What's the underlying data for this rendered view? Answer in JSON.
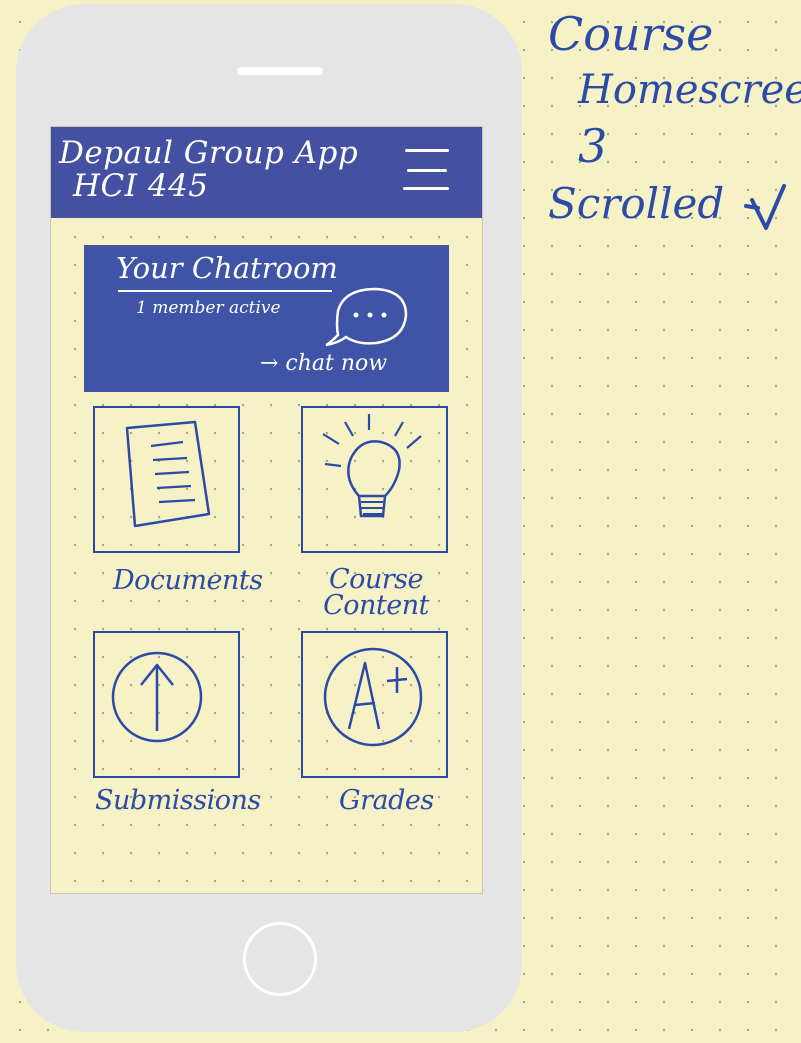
{
  "annotation": {
    "line1": "Course",
    "line2": "Homescreen",
    "line3": "3",
    "line4": "Scrolled"
  },
  "app": {
    "title": "Depaul Group App",
    "course_code": "HCI 445"
  },
  "chatroom": {
    "title": "Your Chatroom",
    "members": "1 member active",
    "action": "→ chat now"
  },
  "tiles": [
    {
      "label": "Documents",
      "icon": "document-icon"
    },
    {
      "label": "Course Content",
      "icon": "lightbulb-icon"
    },
    {
      "label": "Submissions",
      "icon": "upload-arrow-icon"
    },
    {
      "label": "Grades",
      "icon": "grade-a-plus-icon"
    }
  ],
  "colors": {
    "paper": "#f6f2c6",
    "ink": "#2c4aa8",
    "header": "#4451a3",
    "phone_frame": "#e5e5e6"
  }
}
